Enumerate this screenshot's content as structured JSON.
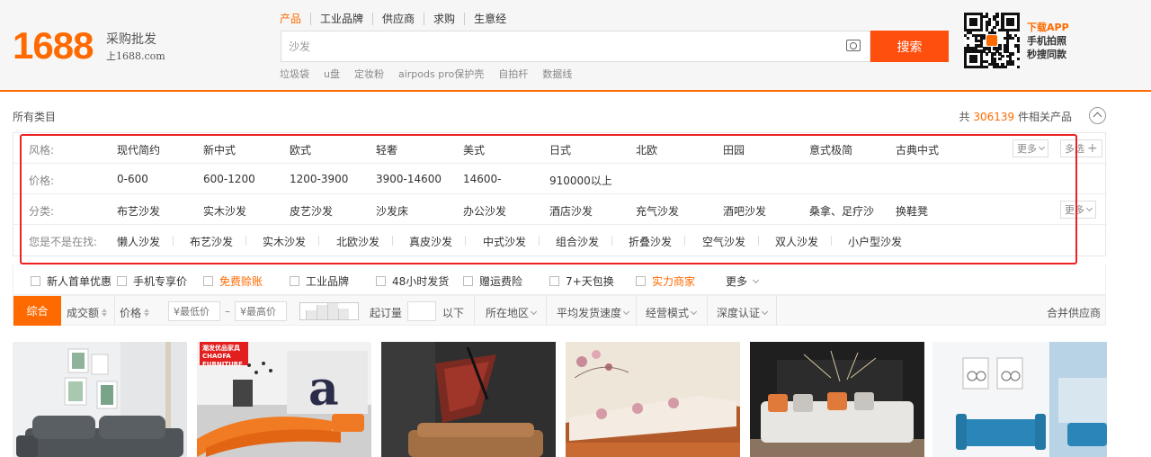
{
  "logo": {
    "number": "1688",
    "tagline": "采购批发",
    "domain": "上1688.com"
  },
  "search": {
    "tabs": [
      "产品",
      "工业品牌",
      "供应商",
      "求购",
      "生意经"
    ],
    "active_tab": "产品",
    "query": "沙发",
    "button_label": "搜索",
    "hot_words": [
      "垃圾袋",
      "u盘",
      "定妆粉",
      "airpods pro保护壳",
      "自拍杆",
      "数据线"
    ]
  },
  "app_promo": {
    "line1": "下载APP",
    "line2": "手机拍照",
    "line3": "秒搜同款"
  },
  "breadcrumb": {
    "label": "所有类目"
  },
  "results": {
    "prefix": "共",
    "count": "306139",
    "suffix": "件相关产品"
  },
  "filters": {
    "style": {
      "label": "风格:",
      "options": [
        "现代简约",
        "新中式",
        "欧式",
        "轻奢",
        "美式",
        "日式",
        "北欧",
        "田园",
        "意式极简",
        "古典中式"
      ],
      "more": "更多",
      "multi": "多选"
    },
    "price": {
      "label": "价格:",
      "options": [
        "0-600",
        "600-1200",
        "1200-3900",
        "3900-14600",
        "14600-",
        "910000以上"
      ]
    },
    "category": {
      "label": "分类:",
      "options": [
        "布艺沙发",
        "实木沙发",
        "皮艺沙发",
        "沙发床",
        "办公沙发",
        "酒店沙发",
        "充气沙发",
        "酒吧沙发",
        "桑拿、足疗沙",
        "换鞋凳"
      ],
      "more": "更多"
    },
    "suggest": {
      "label": "您是不是在找:",
      "options": [
        "懒人沙发",
        "布艺沙发",
        "实木沙发",
        "北欧沙发",
        "真皮沙发",
        "中式沙发",
        "组合沙发",
        "折叠沙发",
        "空气沙发",
        "双人沙发",
        "小户型沙发"
      ]
    }
  },
  "checks": [
    {
      "label": "新人首单优惠",
      "orange": false
    },
    {
      "label": "手机专享价",
      "orange": false
    },
    {
      "label": "免费赊账",
      "orange": true
    },
    {
      "label": "工业品牌",
      "orange": false
    },
    {
      "label": "48小时发货",
      "orange": false
    },
    {
      "label": "赠运费险",
      "orange": false
    },
    {
      "label": "7+天包换",
      "orange": false
    },
    {
      "label": "实力商家",
      "orange": true
    }
  ],
  "checks_more": "更多",
  "sortbar": {
    "comprehensive": "综合",
    "volume": "成交额",
    "price": "价格",
    "min_price_placeholder": "¥最低价",
    "max_price_placeholder": "¥最高价",
    "dash": "–",
    "moq_label": "起订量",
    "moq_suffix": "以下",
    "location": "所在地区",
    "ship_speed": "平均发货速度",
    "biz_model": "经营模式",
    "certification": "深度认证",
    "merge": "合并供应商"
  },
  "products": [
    {
      "name": "gray-sofa-living-room"
    },
    {
      "name": "orange-curved-sofa-office",
      "badge": "潮发优品家具 CHAOFA FURNITURE"
    },
    {
      "name": "brown-sofa-red-art"
    },
    {
      "name": "wood-frame-floral-sofa"
    },
    {
      "name": "white-leather-sofa"
    },
    {
      "name": "blue-office-sofa"
    }
  ],
  "colors": {
    "brand": "#ff6a00",
    "search_button": "#ff4f0f",
    "highlight": "#e22222"
  }
}
